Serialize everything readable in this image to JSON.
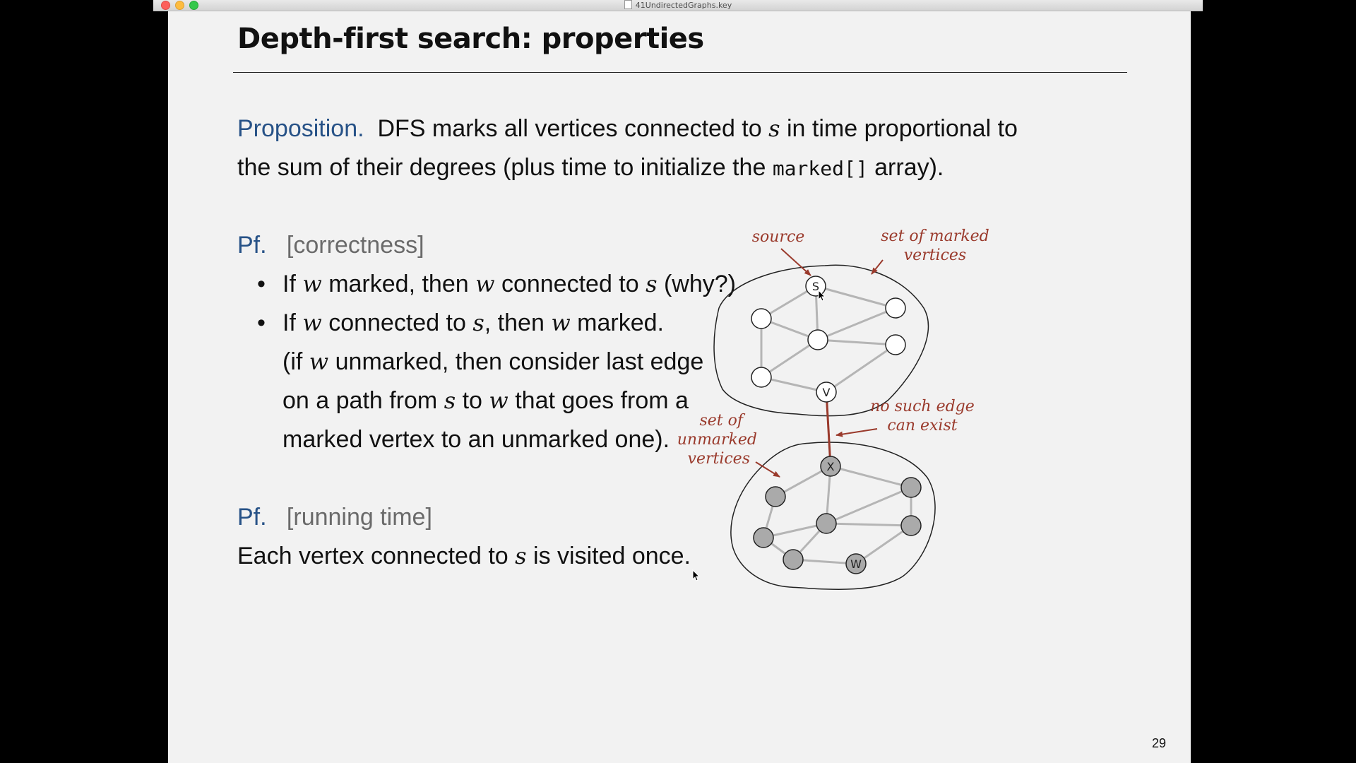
{
  "window": {
    "title": "41UndirectedGraphs.key"
  },
  "slide": {
    "title": "Depth-first search:  properties",
    "page_number": "29",
    "proposition": {
      "label": "Proposition.",
      "t1": "DFS marks all vertices connected to",
      "s1": "s",
      "t2": "in time proportional to",
      "t3": "the sum of their degrees (plus time to initialize the",
      "code": "marked[]",
      "t4": "array)."
    },
    "pf1": {
      "label": "Pf.",
      "bracket": "[correctness]",
      "b1": {
        "a": "If",
        "w1": "w",
        "b": "marked, then",
        "w2": "w",
        "c": "connected to",
        "s": "s",
        "d": "(why?)"
      },
      "b2": {
        "a": "If",
        "w1": "w",
        "b": "connected to",
        "s": "s",
        "c": ", then",
        "w2": "w",
        "d": "marked."
      },
      "l3": {
        "a": "(if",
        "w": "w",
        "b": "unmarked, then consider last edge"
      },
      "l4": {
        "a": "on a path from",
        "s": "s",
        "b": "to",
        "w": "w",
        "c": "that goes from a"
      },
      "l5": "marked vertex to an unmarked one)."
    },
    "pf2": {
      "label": "Pf.",
      "bracket": "[running time]",
      "a": "Each vertex connected to",
      "s": "s",
      "b": "is visited once."
    },
    "bullet_char": "•"
  },
  "diagram": {
    "source_label": "source",
    "marked_label_1": "set of marked",
    "marked_label_2": "vertices",
    "no_edge_label_1": "no such edge",
    "no_edge_label_2": "can exist",
    "unmarked_label_1": "set of",
    "unmarked_label_2": "unmarked",
    "unmarked_label_3": "vertices",
    "vertex_s": "S",
    "vertex_v": "V",
    "vertex_x": "X",
    "vertex_w": "W",
    "annotation_color": "#9a3a2c",
    "edge_color": "#b5b5b5",
    "marked_fill": "#ffffff",
    "unmarked_fill": "#aaaaaa"
  }
}
